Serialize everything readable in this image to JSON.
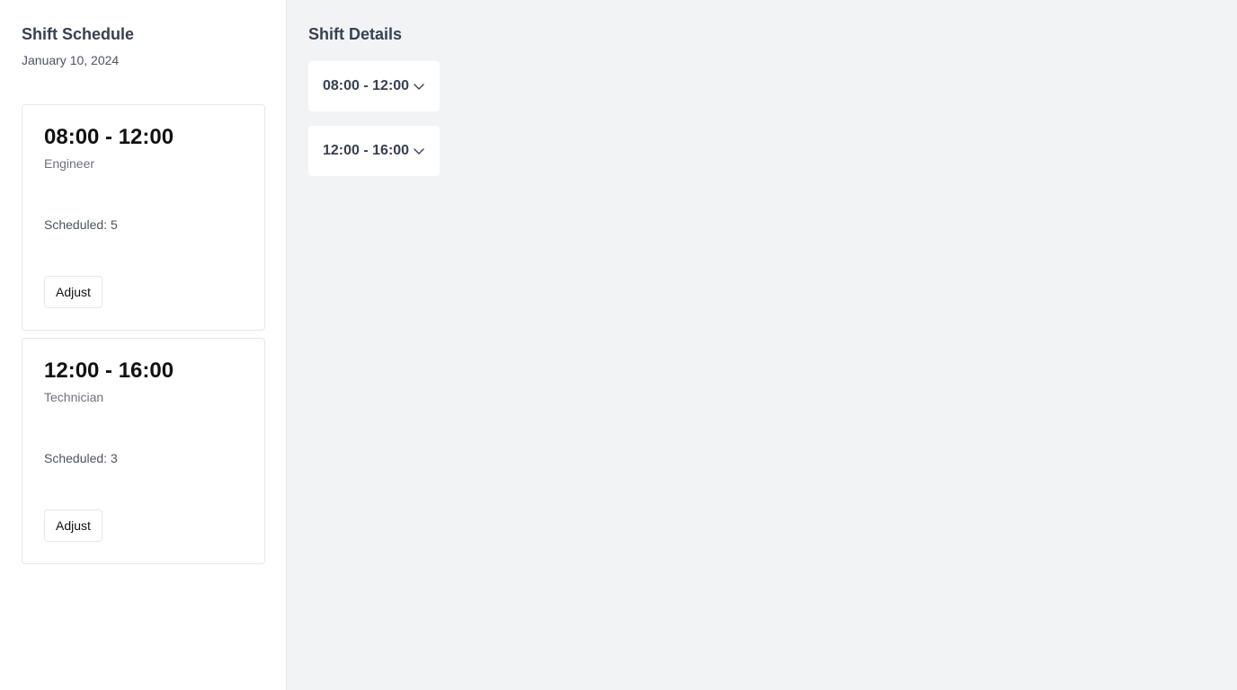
{
  "sidebar": {
    "title": "Shift Schedule",
    "date": "January 10, 2024",
    "shifts": [
      {
        "time": "08:00 - 12:00",
        "role": "Engineer",
        "scheduled": "Scheduled: 5",
        "adjust_label": "Adjust"
      },
      {
        "time": "12:00 - 16:00",
        "role": "Technician",
        "scheduled": "Scheduled: 3",
        "adjust_label": "Adjust"
      }
    ]
  },
  "main": {
    "title": "Shift Details",
    "details": [
      {
        "label": "08:00 - 12:00",
        "icon": "chevron-down-icon"
      },
      {
        "label": "12:00 - 16:00",
        "icon": "chevron-down-icon"
      }
    ]
  },
  "colors": {
    "background": "#f2f3f5",
    "panel": "#ffffff",
    "border": "#e5e7eb",
    "heading": "#374151",
    "muted": "#6b7280"
  }
}
